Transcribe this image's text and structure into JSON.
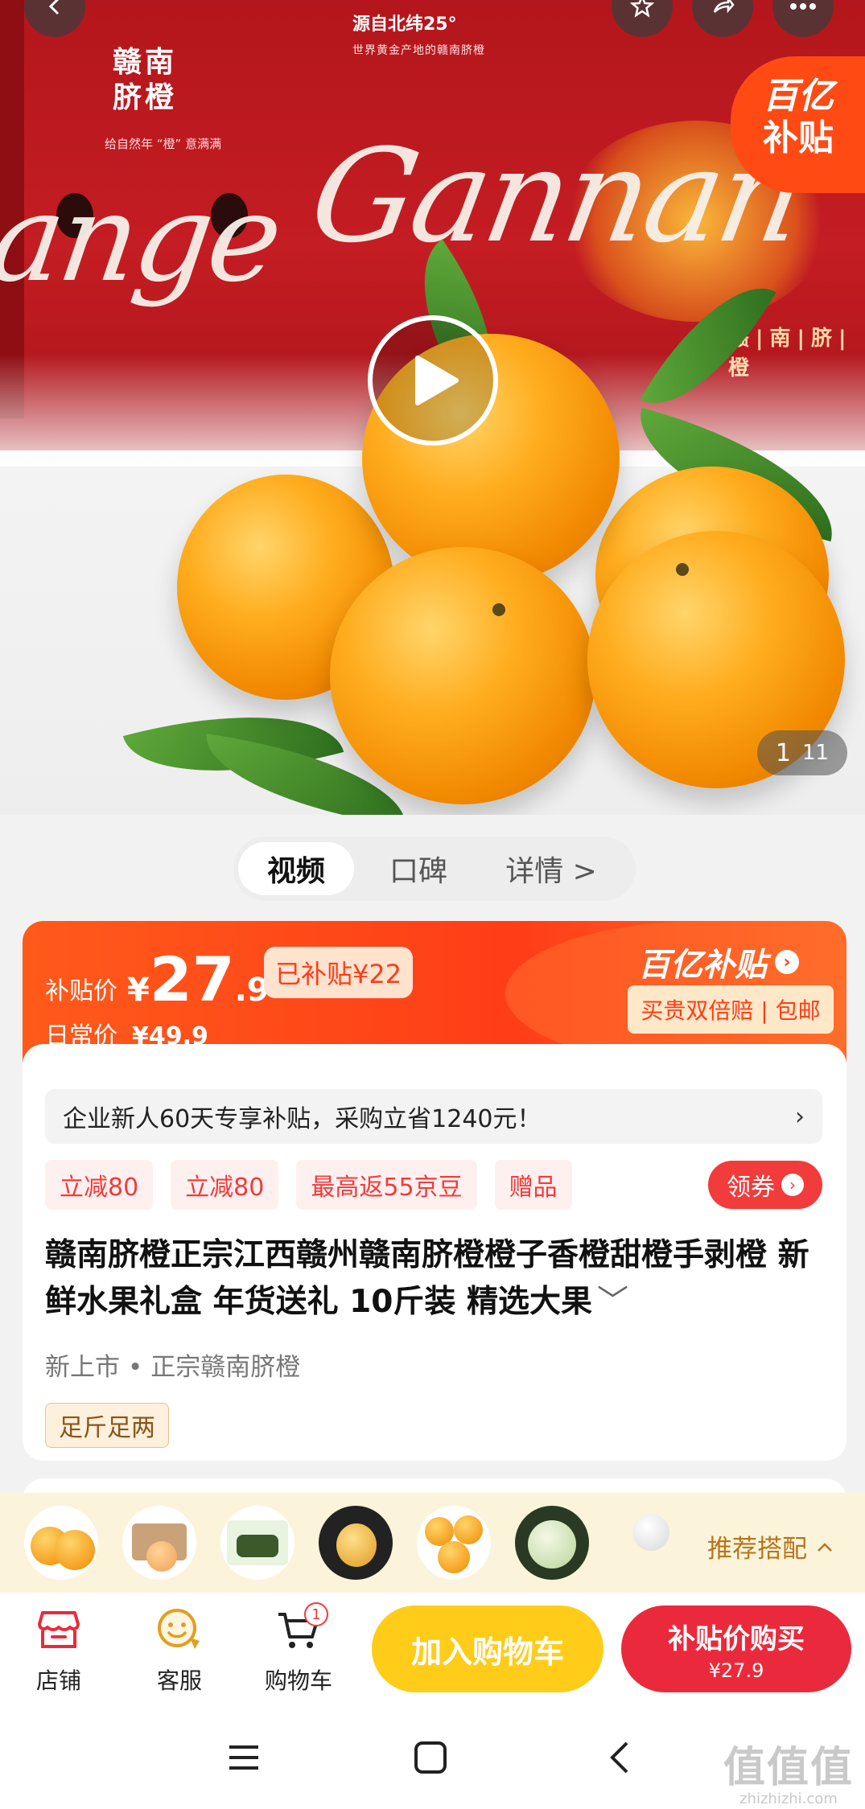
{
  "hero": {
    "box_brand": "赣南脐橙",
    "box_slogan": "给自然年 “橙” 意满满",
    "top_slogan": "源自北纬25°",
    "top_slogan_sub": "世界黄金产地的赣南脐橙",
    "script_left": "ange",
    "script_right": "Gannan",
    "side_brand": "赣|南|脐|橙",
    "badge_line1": "百亿",
    "badge_line2": "补贴",
    "image_index": "1",
    "image_total": "11"
  },
  "tabs": [
    {
      "label": "视频"
    },
    {
      "label": "口碑"
    },
    {
      "label": "详情 >"
    }
  ],
  "price": {
    "label": "补贴价",
    "yen": "¥",
    "integer": "27",
    "decimal": ".9",
    "subsidy_tag": "已补贴¥22",
    "daily_label": "日常价",
    "daily_value": "¥49.9",
    "program_title": "百亿补贴",
    "guarantee": "买贵双倍赔 | 包邮"
  },
  "promo_bar": {
    "text": "企业新人60天专享补贴，采购立省1240元！",
    "chevron": "›"
  },
  "tags": [
    "立减80",
    "立减80",
    "最高返55京豆",
    "赠品"
  ],
  "coupon_button": "领券",
  "product": {
    "title": "赣南脐橙正宗江西赣州赣南脐橙橙子香橙甜橙手剥橙 新鲜水果礼盒 年货送礼 10斤装 精选大果",
    "meta_1": "新上市",
    "meta_sep": "•",
    "meta_2": "正宗赣南脐橙",
    "feature_tag": "足斤足两"
  },
  "recommend": {
    "label": "推荐搭配",
    "thumbs": [
      "orange-mandarins",
      "cantaloupe-box",
      "grape-box",
      "pear",
      "mandarins",
      "melon",
      "snow-pear"
    ]
  },
  "bottom_bar": {
    "shop": "店铺",
    "service": "客服",
    "cart": "购物车",
    "cart_count": "1",
    "add_to_cart": "加入购物车",
    "buy_now": "补贴价购买",
    "buy_price": "¥27.9"
  },
  "watermark": {
    "big": "值值值",
    "small": "zhizhizhi.com"
  },
  "colors": {
    "accent_red": "#ea2a3c",
    "subsidy_orange": "#ff4a14",
    "cart_yellow": "#ffcc1a",
    "recommend_bg": "#fbf4db"
  }
}
